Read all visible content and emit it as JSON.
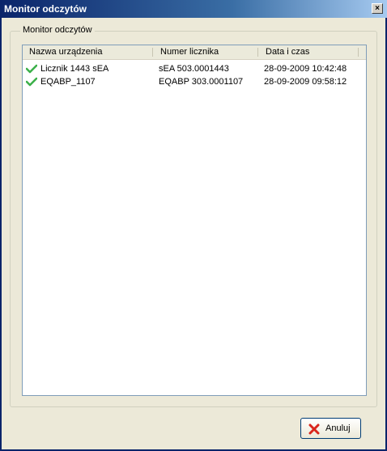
{
  "window": {
    "title": "Monitor odczytów",
    "close_glyph": "×"
  },
  "group": {
    "legend": "Monitor odczytów"
  },
  "list": {
    "columns": [
      "Nazwa urządzenia",
      "Numer licznika",
      "Data i czas"
    ],
    "rows": [
      {
        "status_icon": "check-icon",
        "name": "Licznik 1443 sEA",
        "meter": "sEA 503.0001443",
        "datetime": "28-09-2009 10:42:48"
      },
      {
        "status_icon": "check-icon",
        "name": "EQABP_1107",
        "meter": "EQABP 303.0001107",
        "datetime": "28-09-2009 09:58:12"
      }
    ]
  },
  "buttons": {
    "cancel_label": "Anuluj",
    "cancel_icon": "red-x-icon"
  },
  "colors": {
    "title_bar": "#0a246a",
    "dialog_bg": "#ece9d8",
    "list_border": "#7f9db9",
    "check_green": "#3cb04a",
    "cancel_red": "#d9261c"
  }
}
